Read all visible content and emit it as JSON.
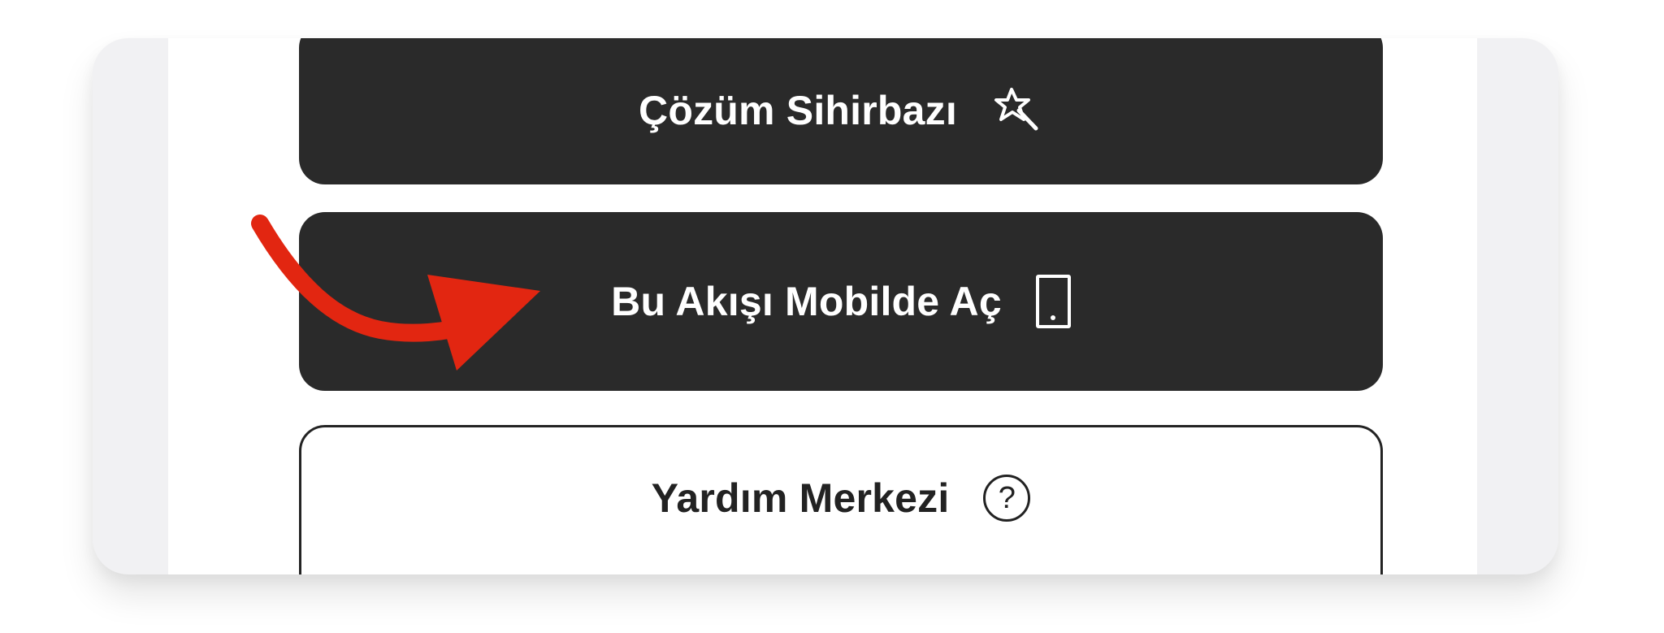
{
  "menu": {
    "wizard_button": {
      "label": "Çözüm Sihirbazı",
      "icon": "magic-wand-icon"
    },
    "mobile_button": {
      "label": "Bu Akışı Mobilde Aç",
      "icon": "mobile-phone-icon"
    },
    "help_button": {
      "label": "Yardım Merkezi",
      "icon": "question-circle-icon",
      "icon_glyph": "?"
    }
  },
  "annotation": {
    "type": "red-curved-arrow",
    "color": "#e22611",
    "points_to": "mobile_button"
  },
  "colors": {
    "dark_button": "#2a2a2a",
    "light_button_border": "#232323",
    "background": "#f1f1f3"
  }
}
